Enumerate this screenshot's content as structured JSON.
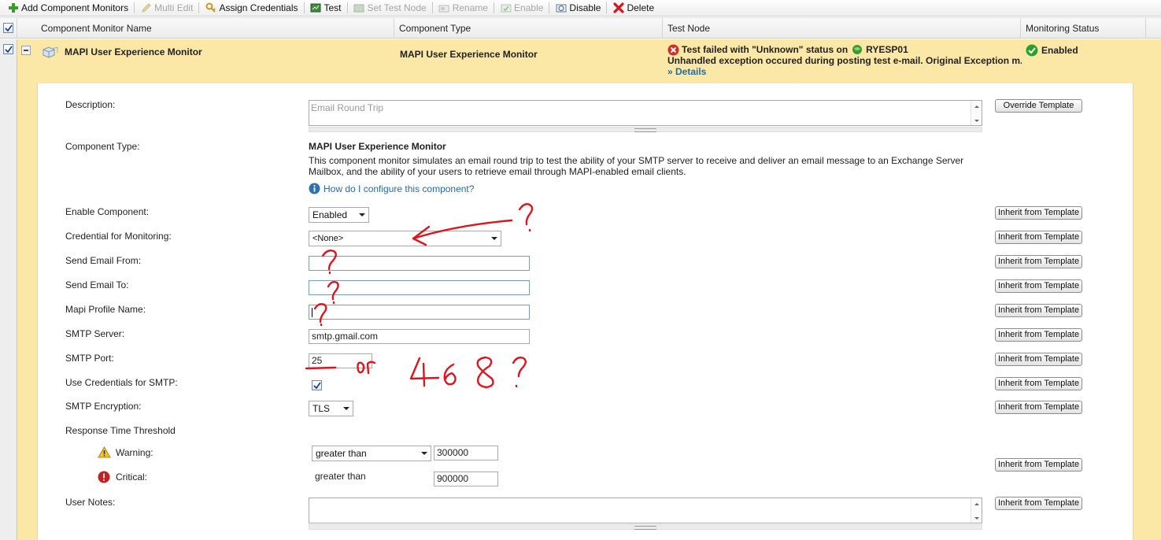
{
  "toolbar": {
    "add": "Add Component Monitors",
    "multi_edit": "Multi Edit",
    "assign": "Assign Credentials",
    "test": "Test",
    "set_test_node": "Set Test Node",
    "rename": "Rename",
    "enable": "Enable",
    "disable": "Disable",
    "delete": "Delete"
  },
  "grid": {
    "headers": {
      "name": "Component Monitor Name",
      "type": "Component Type",
      "test_node": "Test Node",
      "status": "Monitoring Status"
    },
    "row": {
      "name": "MAPI User Experience Monitor",
      "type": "MAPI User Experience Monitor",
      "test_status": "Test failed with \"Unknown\" status on",
      "test_node": "RYESP01",
      "test_message": "Unhandled exception occured during posting test e-mail. Original Exception m...",
      "details": "» Details",
      "monitoring_status": "Enabled"
    }
  },
  "form": {
    "description": {
      "label": "Description:",
      "placeholder": "Email Round Trip",
      "button": "Override Template"
    },
    "component_type": {
      "label": "Component Type:",
      "title": "MAPI User Experience Monitor",
      "desc1": "This component monitor simulates an email round trip to test the ability of your SMTP server to receive and deliver an email message to an Exchange Server",
      "desc2": "Mailbox, and the ability of your users to retrieve email through MAPI-enabled email clients.",
      "help": "How do I configure this component?"
    },
    "inherit_label": "Inherit from Template",
    "enable_component": {
      "label": "Enable Component:",
      "value": "Enabled"
    },
    "credential": {
      "label": "Credential for Monitoring:",
      "value": "<None>"
    },
    "send_from": {
      "label": "Send Email From:",
      "value": ""
    },
    "send_to": {
      "label": "Send Email To:",
      "value": ""
    },
    "mapi_profile": {
      "label": "Mapi Profile Name:",
      "value": ""
    },
    "smtp_server": {
      "label": "SMTP Server:",
      "value": "smtp.gmail.com"
    },
    "smtp_port": {
      "label": "SMTP Port:",
      "value": "25"
    },
    "use_credentials": {
      "label": "Use Credentials for SMTP:",
      "checked": true
    },
    "smtp_encryption": {
      "label": "SMTP Encryption:",
      "value": "TLS"
    },
    "threshold": {
      "label": "Response Time Threshold",
      "warning_label": "Warning:",
      "warning_op": "greater than",
      "warning_value": "300000",
      "critical_label": "Critical:",
      "critical_op": "greater than",
      "critical_value": "900000"
    },
    "user_notes": {
      "label": "User Notes:",
      "value": ""
    }
  },
  "annotations": {
    "handwritten": "or 468 ?"
  },
  "colors": {
    "row_highlight": "#fbe8a6",
    "link": "#1f6bb0",
    "annotation": "#e0141e"
  }
}
